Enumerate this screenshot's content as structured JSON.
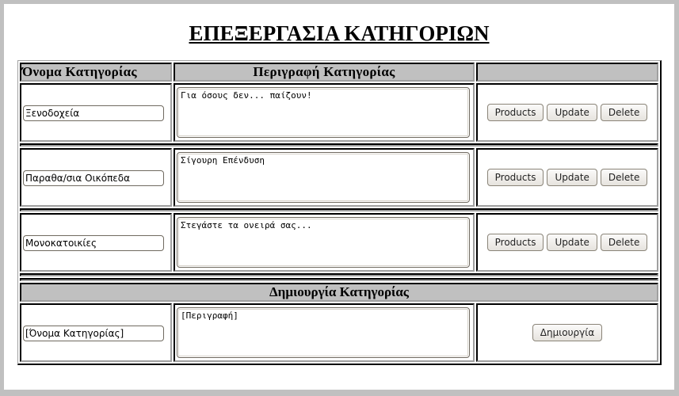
{
  "page": {
    "title": "ΕΠΕΞΕΡΓΑΣΙΑ ΚΑΤΗΓΟΡΙΩΝ"
  },
  "table": {
    "headers": {
      "name": "Όνομα Κατηγορίας",
      "description": "Περιγραφή Κατηγορίας",
      "actions": ""
    },
    "rows": [
      {
        "name": "Ξενοδοχεία",
        "description": "Για όσους δεν... παίζουν!",
        "buttons": {
          "products": "Products",
          "update": "Update",
          "delete": "Delete"
        }
      },
      {
        "name": "Παραθα/σια Οικόπεδα",
        "description": "Σίγουρη Επένδυση",
        "buttons": {
          "products": "Products",
          "update": "Update",
          "delete": "Delete"
        }
      },
      {
        "name": "Μονοκατοικίες",
        "description": "Στεγάστε τα ονειρά σας...",
        "buttons": {
          "products": "Products",
          "update": "Update",
          "delete": "Delete"
        }
      }
    ]
  },
  "create": {
    "header": "Δημιουργία Κατηγορίας",
    "name_value": "[Όνομα Κατηγορίας]",
    "description_value": "[Περιγραφή]",
    "button": "Δημιουργία"
  }
}
